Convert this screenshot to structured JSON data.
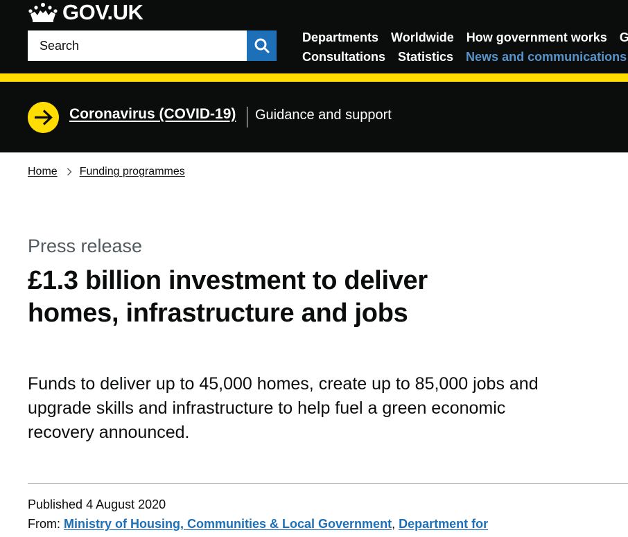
{
  "header": {
    "logo_text": "GOV.UK",
    "search_placeholder": "Search",
    "nav_row1": [
      "Departments",
      "Worldwide",
      "How government works",
      "Get involved"
    ],
    "nav_row2": [
      "Consultations",
      "Statistics",
      "News and communications"
    ],
    "active_nav": "News and communications",
    "colors": {
      "background": "#0b0c0c",
      "search_button": "#1d70b8",
      "active_link": "#5694ca",
      "accent_bar": "#ffdd00"
    }
  },
  "covid_banner": {
    "link": "Coronavirus (COVID-19)",
    "guidance": "Guidance and support"
  },
  "breadcrumb": {
    "home": "Home",
    "section": "Funding programmes"
  },
  "article": {
    "doc_type": "Press release",
    "title": "£1.3 billion investment to deliver homes, infrastructure and jobs",
    "lede": "Funds to deliver up to 45,000 homes, create up to 85,000 jobs and upgrade skills and infrastructure to help fuel a green economic recovery announced.",
    "published_label": "Published",
    "published_date": "4 August 2020",
    "from_label": "From:",
    "from_org_1": "Ministry of Housing, Communities & Local Government",
    "from_sep": ",",
    "from_org_2": "Department for"
  }
}
